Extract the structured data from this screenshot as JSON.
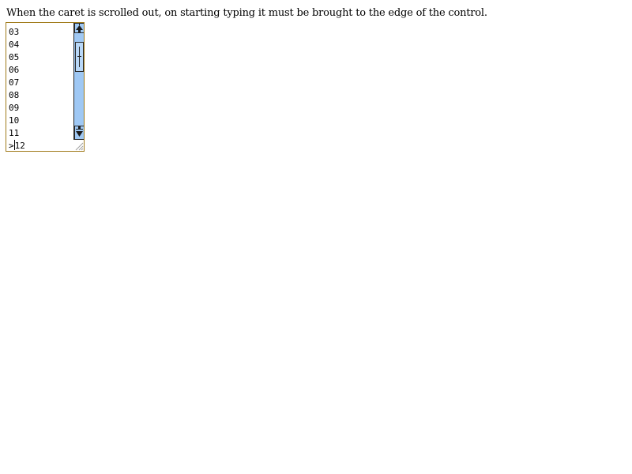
{
  "instruction": {
    "text": "When the caret is scrolled out, on starting typing it must be brought to the edge of the control."
  },
  "textarea": {
    "lines": [
      "03",
      "04",
      "05",
      "06",
      "07",
      "08",
      "09",
      "10",
      "11"
    ],
    "last_line_prefix": ">",
    "last_line_suffix": "12",
    "border_color": "#a07a1a"
  },
  "scrollbar": {
    "track_color": "#9fc8f4",
    "up_icon": "arrow-up-icon",
    "down_icon": "arrow-down-icon"
  }
}
